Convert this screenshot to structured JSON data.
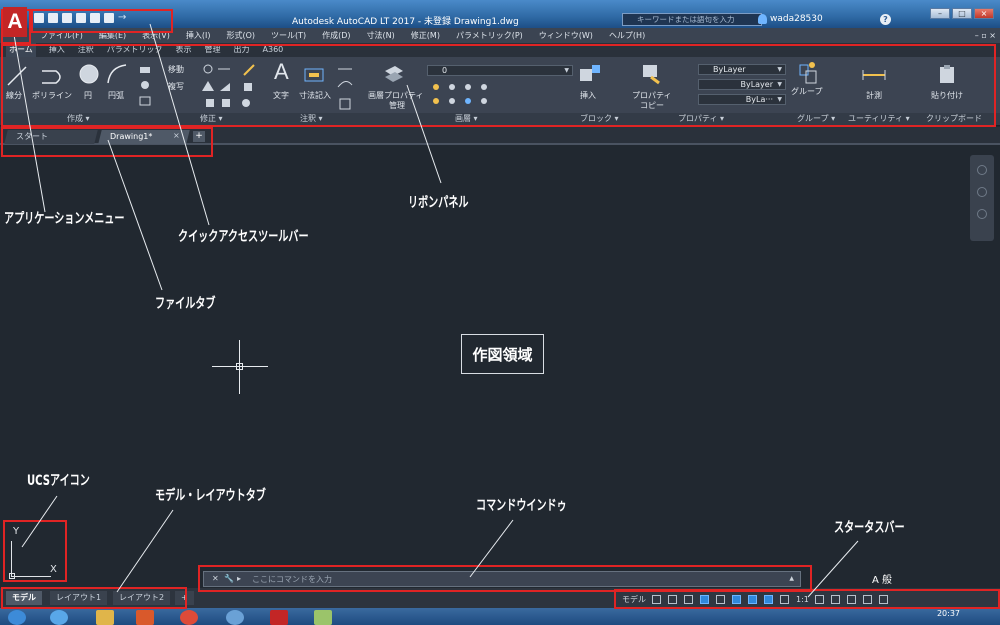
{
  "window": {
    "title": "Autodesk AutoCAD LT 2017 - 未登録   Drawing1.dwg",
    "app_button": "A",
    "search_placeholder": "キーワードまたは語句を入力",
    "user": "wada28530",
    "help_icon": "?"
  },
  "menu": [
    "ファイル(F)",
    "編集(E)",
    "表示(V)",
    "挿入(I)",
    "形式(O)",
    "ツール(T)",
    "作成(D)",
    "寸法(N)",
    "修正(M)",
    "パラメトリック(P)",
    "ウィンドウ(W)",
    "ヘルプ(H)"
  ],
  "ribbon_tabs": [
    "ホーム",
    "挿入",
    "注釈",
    "パラメトリック",
    "表示",
    "管理",
    "出力",
    "A360"
  ],
  "ribbon": {
    "draw": {
      "title": "作成 ▾",
      "line": "線分",
      "polyline": "ポリライン",
      "circle": "円",
      "arc": "円弧"
    },
    "modify": {
      "title": "修正 ▾",
      "move": "移動",
      "copy": "複写"
    },
    "annotation": {
      "title": "注釈 ▾",
      "text": "文字",
      "dimension": "寸法記入"
    },
    "layers": {
      "title": "画層 ▾",
      "properties": "画層プロパティ",
      "properties2": "管理",
      "current": "0"
    },
    "block": {
      "title": "ブロック ▾",
      "insert": "挿入"
    },
    "properties": {
      "title": "プロパティ ▾",
      "match": "プロパティ",
      "match2": "コピー",
      "color": "ByLayer",
      "linetype": "ByLayer",
      "lineweight": "ByLa···"
    },
    "groups": {
      "title": "グループ ▾",
      "group": "グループ"
    },
    "utilities": {
      "title": "ユーティリティ ▾",
      "measure": "計測"
    },
    "clipboard": {
      "title": "クリップボード",
      "paste": "貼り付け"
    }
  },
  "file_tabs": {
    "start": "スタート",
    "doc": "Drawing1*",
    "close": "×",
    "add": "+"
  },
  "ucs": {
    "y": "Y",
    "x": "X"
  },
  "command_line": {
    "placeholder": "ここにコマンドを入力"
  },
  "layout_tabs": [
    "モデル",
    "レイアウト1",
    "レイアウト2"
  ],
  "status": {
    "model": "モデル",
    "scale": "1:1"
  },
  "tray": {
    "ime": "A 般"
  },
  "clock": "20:37",
  "callouts": {
    "app_menu": "アプリケーションメニュー",
    "qat": "クイックアクセスツールバー",
    "ribbon": "リボンパネル",
    "file_tab": "ファイルタブ",
    "drawing_area": "作図領域",
    "ucs": "UCSアイコン",
    "layout_tabs": "モデル・レイアウトタブ",
    "command_window": "コマンドウインドゥ",
    "status_bar": "スタータスバー"
  }
}
